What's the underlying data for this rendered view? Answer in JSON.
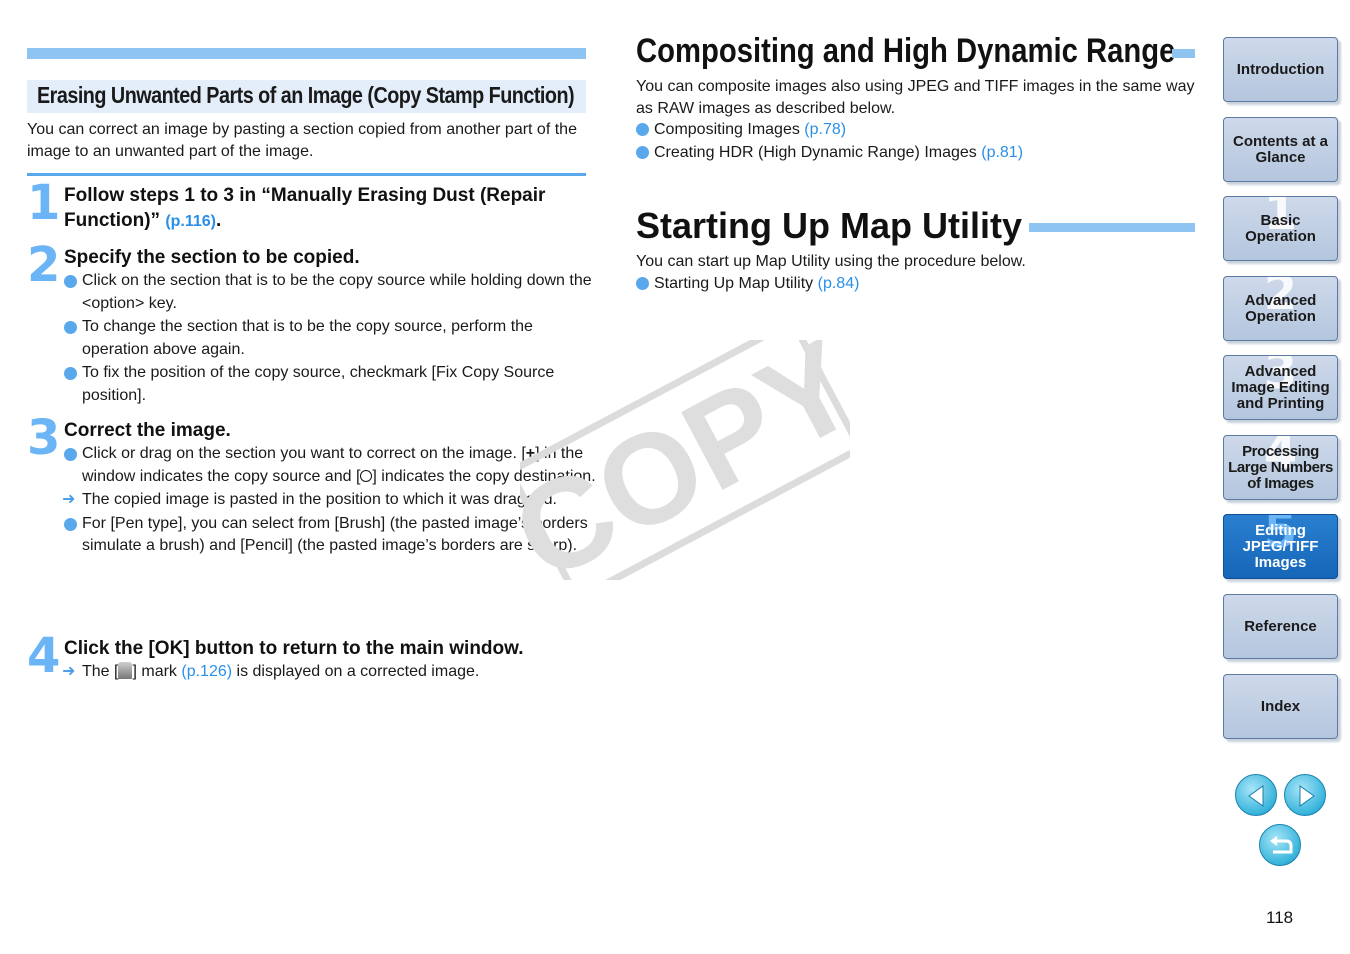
{
  "left": {
    "section_title": "Erasing Unwanted Parts of an Image (Copy Stamp Function)",
    "intro": "You can correct an image by pasting a section copied from another part of the image to an unwanted part of the image.",
    "steps": [
      {
        "num": "1",
        "head": "Follow steps 1 to 3 in “Manually Erasing Dust (Repair Function)”",
        "link": "(p.116)",
        "tail": "."
      },
      {
        "num": "2",
        "head": "Specify the section to be copied.",
        "items": [
          "Click on the section that is to be the copy source while holding down the <option> key.",
          "To change the section that is to be the copy source, perform the operation above again.",
          "To fix the position of the copy source, checkmark [Fix Copy Source position]."
        ]
      },
      {
        "num": "3",
        "head": "Correct the image.",
        "item1_a": "Click or drag on the section you want to correct on the image. [",
        "item1_b": "] in the window indicates the copy source and [",
        "item1_c": "] indicates the copy destination.",
        "item2": "The copied image is pasted in the position to which it was dragged.",
        "item3": "For [Pen type], you can select from [Brush] (the pasted image’s borders simulate a brush) and [Pencil] (the pasted image’s borders are sharp)."
      },
      {
        "num": "4",
        "head": "Click the [OK] button to return to the main window.",
        "item_a": "The [",
        "item_b": "] mark",
        "item_link": "(p.126)",
        "item_c": "is displayed on a corrected image."
      }
    ]
  },
  "right": {
    "h1_compositing": "Compositing and High Dynamic Range",
    "compositing_text": "You can composite images also using JPEG and TIFF images in the same way as RAW images as described below.",
    "compositing_items": [
      {
        "label": "Compositing Images",
        "link": "(p.78)"
      },
      {
        "label": "Creating HDR (High Dynamic Range) Images",
        "link": "(p.81)"
      }
    ],
    "h1_map": "Starting Up Map Utility",
    "map_text": "You can start up Map Utility using the procedure below.",
    "map_items": [
      {
        "label": "Starting Up Map Utility",
        "link": "(p.84)"
      }
    ]
  },
  "watermark": "COPY",
  "nav": [
    {
      "label": "Introduction",
      "num": ""
    },
    {
      "label": "Contents at a Glance",
      "num": ""
    },
    {
      "label": "Basic Operation",
      "num": "1"
    },
    {
      "label": "Advanced Operation",
      "num": "2"
    },
    {
      "label": "Advanced Image Editing and Printing",
      "num": "3"
    },
    {
      "label": "Processing Large Numbers of Images",
      "num": "4"
    },
    {
      "label": "Editing JPEG/TIFF Images",
      "num": "5",
      "active": true
    },
    {
      "label": "Reference",
      "num": ""
    },
    {
      "label": "Index",
      "num": ""
    }
  ],
  "page_number": "118",
  "colors": {
    "accent": "#5aa8ec",
    "link": "#2b8fe8",
    "nav_bg": "#c2d1e6",
    "nav_active": "#1f74c6"
  }
}
